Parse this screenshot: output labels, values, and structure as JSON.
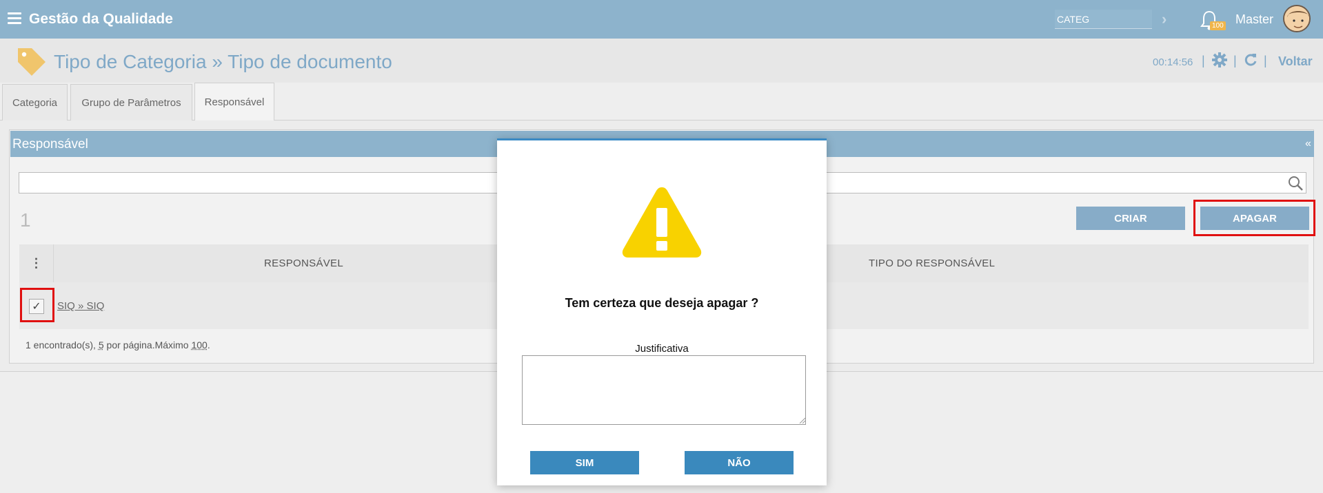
{
  "app": {
    "title": "Gestão da Qualidade"
  },
  "topbar": {
    "search_value": "CATEG",
    "notification_count": "100",
    "user_name": "Master"
  },
  "header": {
    "page_title": "Tipo de Categoria » Tipo de documento",
    "timer": "00:14:56",
    "back_label": "Voltar"
  },
  "tabs": [
    {
      "label": "Categoria"
    },
    {
      "label": "Grupo de Parâmetros"
    },
    {
      "label": "Responsável"
    }
  ],
  "panel": {
    "title": "Responsável",
    "collapse_label": "«",
    "count": "1",
    "create_label": "CRIAR",
    "delete_label": "APAGAR",
    "columns": [
      "RESPONSÁVEL",
      "TIPO DO RESPONSÁVEL"
    ],
    "rows": [
      {
        "checked_mark": "✓",
        "link": "SIQ » SIQ"
      }
    ],
    "footer": {
      "prefix": "1 encontrado(s), ",
      "per_page": "5",
      "mid": " por página.Máximo ",
      "max": "100",
      "suffix": "."
    }
  },
  "dialog": {
    "message": "Tem certeza que deseja apagar ?",
    "justification_label": "Justificativa",
    "yes_label": "SIM",
    "no_label": "NÃO"
  },
  "colors": {
    "topbar": "#8db3cc",
    "accent": "#3a89bd",
    "highlight": "#e01010",
    "warning": "#f8d200"
  }
}
